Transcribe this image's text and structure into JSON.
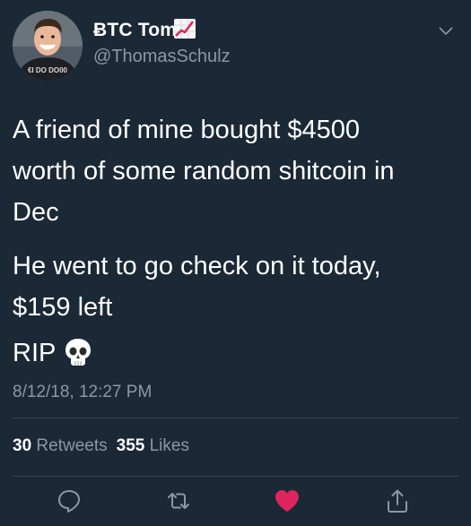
{
  "tweet": {
    "display_name": "ɃTC Tom",
    "handle": "@ThomasSchulz",
    "avatar_shirt_text": "€I DO DO00",
    "paragraphs": [
      [
        "A friend of mine bought $4500",
        "worth of some random shitcoin in",
        "Dec"
      ],
      [
        "He went to go check on it today,",
        "$159 left"
      ]
    ],
    "rip_text": "RIP",
    "timestamp": "8/12/18, 12:27 PM",
    "retweets_count": "30",
    "retweets_label": "Retweets",
    "likes_count": "355",
    "likes_label": "Likes"
  },
  "icons": {
    "name_emoji": "chart-increasing-icon",
    "rip_emoji": "skull-icon",
    "menu": "chevron-down-icon",
    "actions": [
      "reply-icon",
      "retweet-icon",
      "heart-icon",
      "share-icon"
    ]
  },
  "colors": {
    "background": "#1b2836",
    "secondary_text": "#8899a6",
    "divider": "#38444d",
    "like_active": "#e0245e"
  }
}
